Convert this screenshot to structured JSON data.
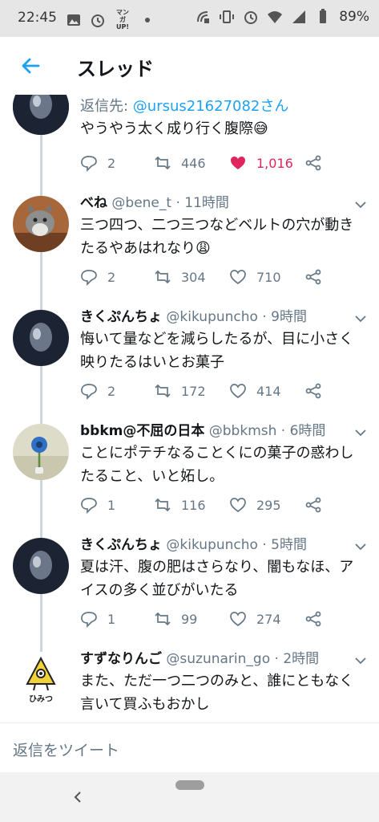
{
  "status_bar": {
    "time": "22:45",
    "manga_icon_text": "マンガ UP!",
    "battery": "89%"
  },
  "header": {
    "title": "スレッド"
  },
  "colors": {
    "accent": "#1da1f2",
    "like": "#e0245e",
    "secondary_text": "#657786"
  },
  "tweets": [
    {
      "reply_to_label": "返信先: ",
      "reply_to_handle": "@ursus21627082さん",
      "text": "やうやう太く成り行く腹際😅",
      "replies": "2",
      "retweets": "446",
      "likes": "1,016",
      "liked": true
    },
    {
      "name": "べね",
      "handle": "@bene_t · 11時間",
      "text": "三つ四つ、二つ三つなどベルトの穴が動きたるやあはれなり😩",
      "replies": "2",
      "retweets": "304",
      "likes": "710"
    },
    {
      "name": "きくぷんちょ",
      "handle": "@kikupuncho · 9時間",
      "text": "悔いて量などを減らしたるが、目に小さく映りたるはいとお菓子",
      "replies": "2",
      "retweets": "172",
      "likes": "414"
    },
    {
      "name": "bbkm@不屈の日本",
      "handle": "@bbkmsh · 6時間",
      "text": "ことにポテチなることくにの菓子の惑わしたること、いと妬し。",
      "replies": "1",
      "retweets": "116",
      "likes": "295"
    },
    {
      "name": "きくぷんちょ",
      "handle": "@kikupuncho · 5時間",
      "text": "夏は汗、腹の肥はさらなり、闇もなほ、アイスの多く並びがいたる",
      "replies": "1",
      "retweets": "99",
      "likes": "274"
    },
    {
      "name": "すずなりんご",
      "handle": "@suzunarin_go · 2時間",
      "text": "また、ただ一つ二つのみと、誰にともなく言いて買ふもおかし",
      "avatar_text": "ひみつ"
    }
  ],
  "reply_bar": {
    "placeholder": "返信をツイート"
  }
}
